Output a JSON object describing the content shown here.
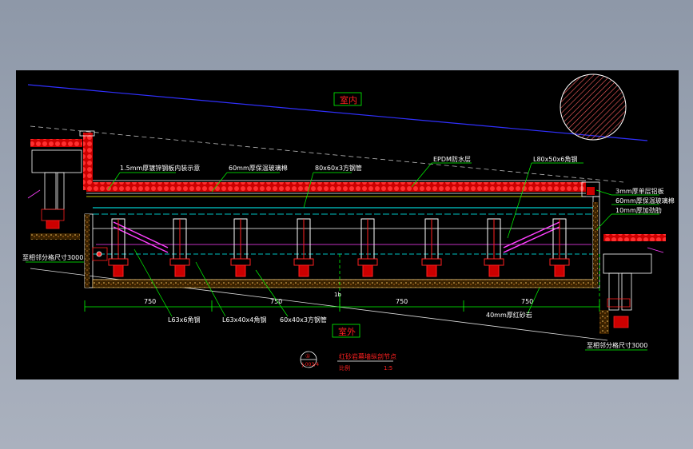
{
  "drawing": {
    "room_inside": "室内",
    "room_outside": "室外",
    "labels": {
      "steel_sheet_ceiling": "1.5mm厚镀锌钢板内装示意",
      "insulation_top": "60mm厚保温玻璃棉",
      "square_tube_top": "80x60x3方钢管",
      "epdm": "EPDM防水层",
      "angle_top": "L80x50x6角钢",
      "aluminum_sheet": "3mm厚单层铝板",
      "insulation_right": "60mm厚保温玻璃棉",
      "stiffener": "10mm厚加劲肋",
      "axis_left": "至相邻分格尺寸3000",
      "axis_right": "至相邻分格尺寸3000",
      "angle_l63_6": "L63x6角钢",
      "angle_l63_40_4": "L63x40x4角钢",
      "square_tube_bottom": "60x40x3方钢管",
      "granite": "40mm厚红砂岩"
    },
    "dimensions": [
      "750",
      "750",
      "750",
      "750"
    ],
    "axis_mark": "1b",
    "title_block": {
      "circle_top": "①",
      "circle_bottom": "J-003/4",
      "title": "红砂岩幕墙纵剖节点",
      "scale_label": "比例",
      "scale": "1:5"
    },
    "colors": {
      "bg": "#000000",
      "red": "#ff2020",
      "yellow": "#ffff00",
      "green": "#00ff00",
      "cyan": "#00ffff",
      "magenta": "#ff40ff",
      "blue": "#3030ff",
      "white": "#ffffff"
    }
  }
}
